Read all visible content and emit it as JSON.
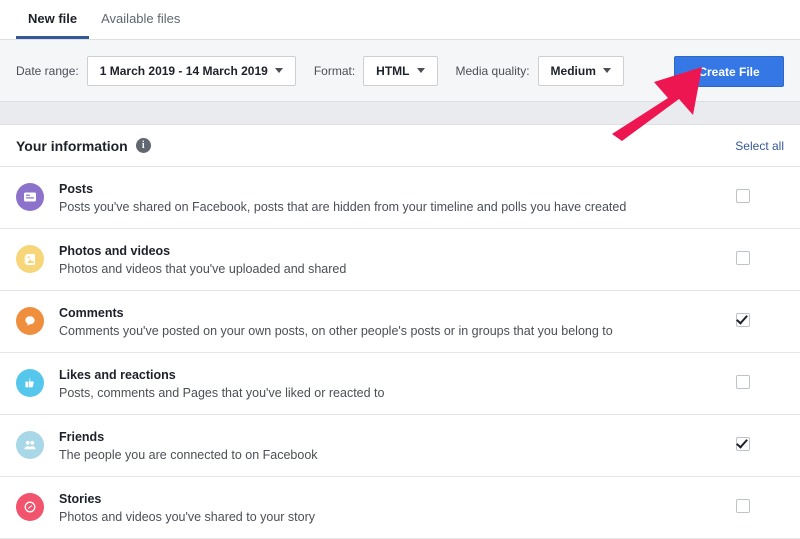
{
  "tabs": [
    {
      "label": "New file",
      "active": true
    },
    {
      "label": "Available files",
      "active": false
    }
  ],
  "toolbar": {
    "date_range_label": "Date range:",
    "date_range_value": "1 March 2019 - 14 March 2019",
    "format_label": "Format:",
    "format_value": "HTML",
    "media_quality_label": "Media quality:",
    "media_quality_value": "Medium",
    "create_file_label": "Create File",
    "create_button_color": "#3578e5"
  },
  "panel": {
    "title": "Your information",
    "info_glyph": "i",
    "select_all_label": "Select all",
    "link_color": "#365899"
  },
  "items": [
    {
      "title": "Posts",
      "description": "Posts you've shared on Facebook, posts that are hidden from your timeline and polls you have created",
      "icon": "posts-icon",
      "icon_color": "#8c72cb",
      "checked": false
    },
    {
      "title": "Photos and videos",
      "description": "Photos and videos that you've uploaded and shared",
      "icon": "photos-videos-icon",
      "icon_color": "#f7d67a",
      "checked": false
    },
    {
      "title": "Comments",
      "description": "Comments you've posted on your own posts, on other people's posts or in groups that you belong to",
      "icon": "comments-icon",
      "icon_color": "#ef8e3d",
      "checked": true
    },
    {
      "title": "Likes and reactions",
      "description": "Posts, comments and Pages that you've liked or reacted to",
      "icon": "thumbs-up-icon",
      "icon_color": "#55c7ec",
      "checked": false
    },
    {
      "title": "Friends",
      "description": "The people you are connected to on Facebook",
      "icon": "friends-icon",
      "icon_color": "#a8d8e8",
      "checked": true
    },
    {
      "title": "Stories",
      "description": "Photos and videos you've shared to your story",
      "icon": "stories-icon",
      "icon_color": "#f2536d",
      "checked": false
    }
  ],
  "annotation": {
    "type": "arrow",
    "color": "#ed1651",
    "points_to": "Create File"
  }
}
